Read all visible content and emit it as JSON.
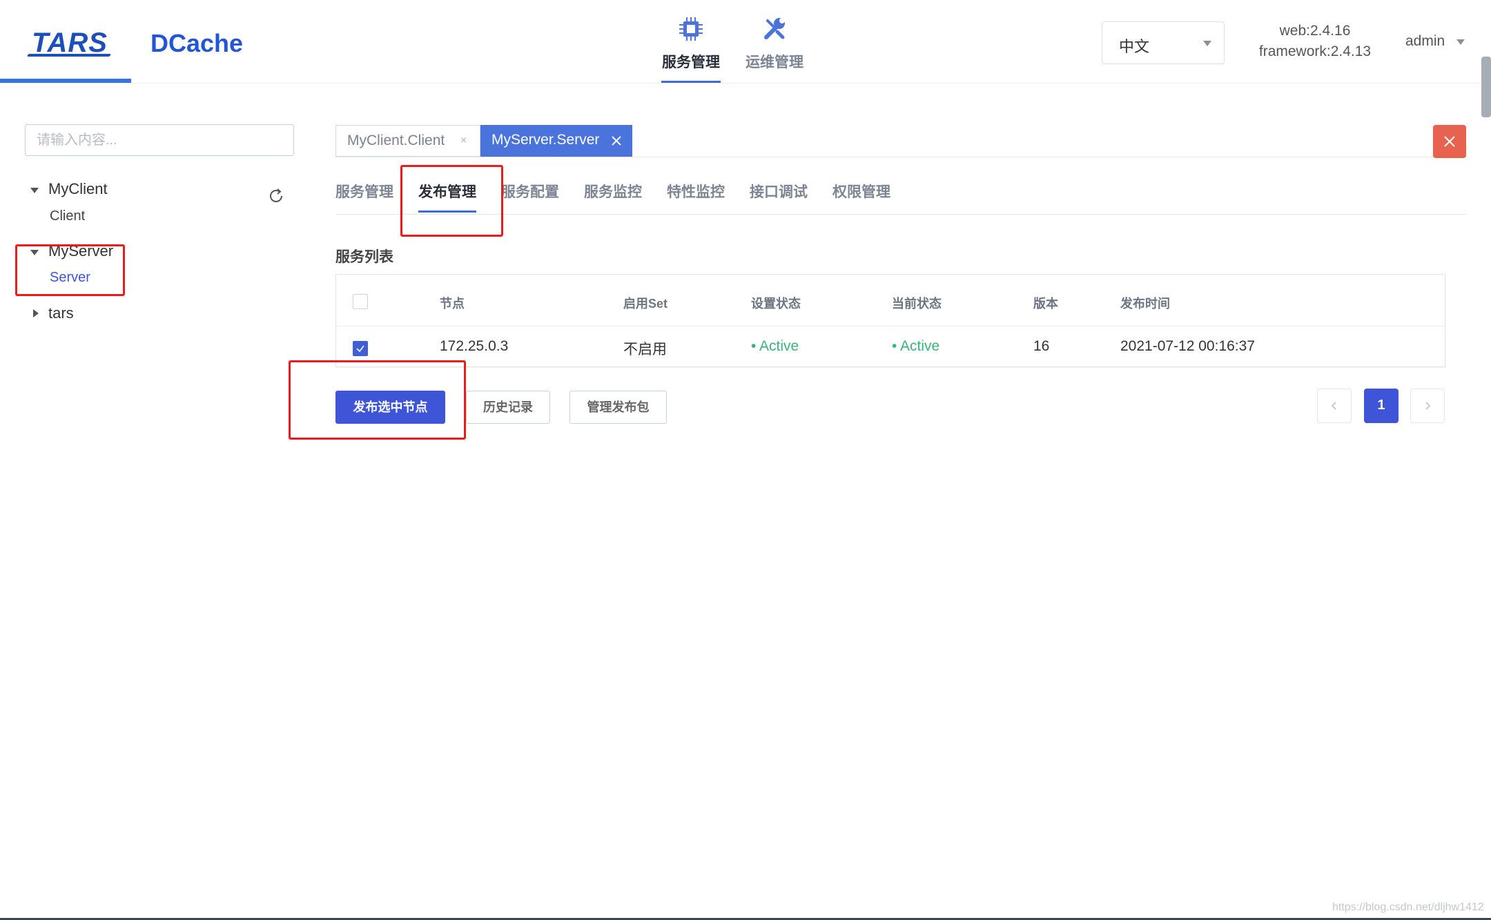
{
  "header": {
    "logo_tars": "TARS",
    "logo_dcache": "DCache",
    "nav": [
      {
        "label": "服务管理",
        "icon": "chip-icon",
        "active": true
      },
      {
        "label": "运维管理",
        "icon": "wrench-icon",
        "active": false
      }
    ],
    "language": "中文",
    "version_web": "web:2.4.16",
    "version_framework": "framework:2.4.13",
    "user": "admin"
  },
  "sidebar": {
    "search_placeholder": "请输入内容...",
    "tree": [
      {
        "label": "MyClient",
        "expanded": true,
        "children": [
          "Client"
        ]
      },
      {
        "label": "MyServer",
        "expanded": true,
        "children": [
          "Server"
        ]
      },
      {
        "label": "tars",
        "expanded": false,
        "children": []
      }
    ]
  },
  "main": {
    "service_tabs": [
      {
        "label": "MyClient.Client",
        "active": false
      },
      {
        "label": "MyServer.Server",
        "active": true
      }
    ],
    "sub_tabs": [
      "服务管理",
      "发布管理",
      "服务配置",
      "服务监控",
      "特性监控",
      "接口调试",
      "权限管理"
    ],
    "active_sub_tab": "发布管理",
    "section_title": "服务列表",
    "table": {
      "columns": [
        "节点",
        "启用Set",
        "设置状态",
        "当前状态",
        "版本",
        "发布时间"
      ],
      "rows": [
        {
          "checked": true,
          "node": "172.25.0.3",
          "set": "不启用",
          "setting_status": "• Active",
          "current_status": "• Active",
          "version": "16",
          "publish_time": "2021-07-12 00:16:37"
        }
      ]
    },
    "buttons": {
      "publish": "发布选中节点",
      "history": "历史记录",
      "manage_packages": "管理发布包"
    },
    "pagination": {
      "current_page": "1"
    }
  },
  "watermark": "https://blog.csdn.net/dljhw1412",
  "colors": {
    "accent": "#3d55d6",
    "active_tab": "#4a74dc",
    "close_button": "#e8634f",
    "status_active": "#3ab67a",
    "annotation": "#ec1c1c"
  }
}
